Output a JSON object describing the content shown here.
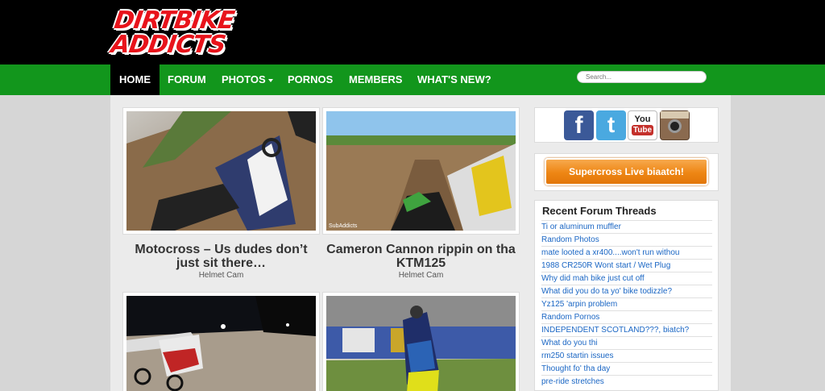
{
  "site": {
    "logo_line1": "DIRTBIKE",
    "logo_line2": "ADDICTS",
    "logo_color": "#e8131b"
  },
  "nav": {
    "items": [
      {
        "label": "HOME",
        "active": true
      },
      {
        "label": "FORUM"
      },
      {
        "label": "PHOTOS",
        "has_dropdown": true
      },
      {
        "label": "PORNOS"
      },
      {
        "label": "MEMBERS"
      },
      {
        "label": "WHAT'S NEW?"
      }
    ],
    "search_placeholder": "Search...",
    "bar_color": "#12961c"
  },
  "posts": [
    {
      "title": "Motocross – Us dudes don’t just sit there…",
      "category": "Helmet Cam"
    },
    {
      "title": "Cameron Cannon rippin on tha KTM125",
      "category": "Helmet Cam",
      "image_watermark": "SubAddicts"
    },
    {
      "title": "",
      "category": ""
    },
    {
      "title": "",
      "category": ""
    }
  ],
  "social": [
    {
      "name": "facebook-icon",
      "glyph": "f",
      "color": "#3b5998"
    },
    {
      "name": "twitter-icon",
      "glyph": "t",
      "color": "#4aa9e0"
    },
    {
      "name": "youtube-icon",
      "glyph": "You Tube",
      "color": "#c4302b"
    },
    {
      "name": "instagram-icon",
      "glyph": "",
      "color": "#8a6a4f"
    }
  ],
  "promo": {
    "label": "Supercross Live biaatch!"
  },
  "forum": {
    "title": "Recent Forum Threads",
    "threads": [
      "Ti or aluminum muffler",
      "Random Photos",
      "mate looted a xr400....won't run withou",
      "1988 CR250R Wont start / Wet Plug",
      "Why did mah bike just cut off",
      "What did you do ta yo' bike todizzle?",
      "Yz125 'arpin problem",
      "Random Pornos",
      "INDEPENDENT SCOTLAND???, biatch?",
      "What do you thi",
      "rm250 startin issues",
      "Thought fo' tha day",
      "pre-ride stretches"
    ]
  }
}
